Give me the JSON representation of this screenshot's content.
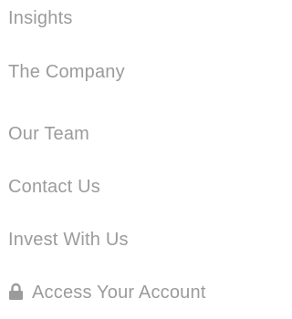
{
  "nav": {
    "items": [
      {
        "label": "Insights"
      },
      {
        "label": "The Company"
      },
      {
        "label": "Our Team"
      },
      {
        "label": "Contact Us"
      },
      {
        "label": "Invest With Us"
      },
      {
        "label": "Access Your Account",
        "icon": "lock-icon"
      }
    ]
  },
  "colors": {
    "text": "#9b9b9b",
    "icon": "#9b9b9b",
    "background": "#ffffff"
  }
}
